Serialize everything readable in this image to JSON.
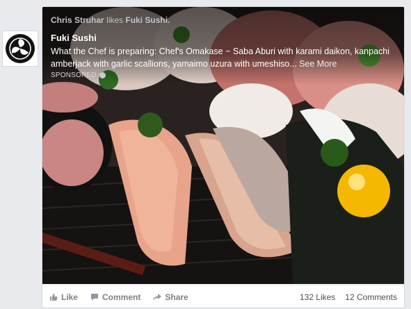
{
  "story": {
    "actor": "Chris Struhar",
    "verb": "likes",
    "object": "Fuki Sushi."
  },
  "ad": {
    "page_name": "Fuki Sushi",
    "description": "What the Chef is preparing: Chef's Omakase ~ Saba Aburi with karami daikon, kanpachi amberjack with garlic scallions, yamaimo uzura with umeshiso...",
    "see_more": "See More",
    "sponsored": "SPONSORED"
  },
  "actions": {
    "like": "Like",
    "comment": "Comment",
    "share": "Share"
  },
  "counts": {
    "likes": "132 Likes",
    "comments": "12 Comments"
  }
}
